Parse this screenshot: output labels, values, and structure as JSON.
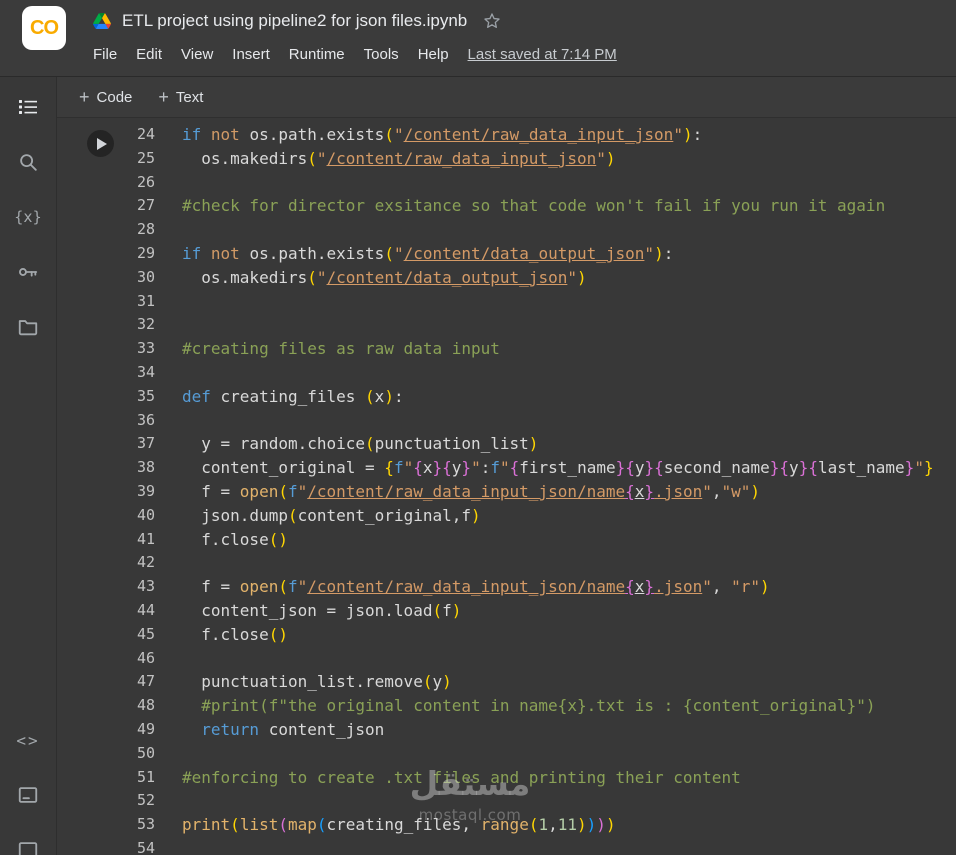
{
  "header": {
    "logo_text": "CO",
    "title": "ETL project using pipeline2 for json files.ipynb",
    "menu": [
      "File",
      "Edit",
      "View",
      "Insert",
      "Runtime",
      "Tools",
      "Help"
    ],
    "last_saved": "Last saved at 7:14 PM"
  },
  "toolbar": {
    "code_label": "Code",
    "text_label": "Text"
  },
  "icons": {
    "plus": "+",
    "variables": "{x}",
    "code_snippets": "<>"
  },
  "watermark": {
    "arabic": "مستقل",
    "domain": "mostaql.com"
  },
  "colors": {
    "logo_orange": "#f9ab00",
    "text": "#d9d9d9",
    "keyword": "#569cd6",
    "not_keyword": "#d19a66",
    "string": "#d49a66",
    "comment": "#8aa156",
    "builtin": "#e3b36b",
    "number": "#b5cea8",
    "bracket_gold": "#ffd602",
    "bracket_pink": "#da70d6",
    "bracket_blue": "#179fff"
  },
  "editor": {
    "lines": [
      {
        "num": 24,
        "tokens": [
          [
            "k",
            "if"
          ],
          [
            "t",
            " "
          ],
          [
            "o",
            "not"
          ],
          [
            "t",
            " os.path.exists"
          ],
          [
            "g",
            "("
          ],
          [
            "s",
            "\""
          ],
          [
            "su",
            "/content/raw_data_input_json"
          ],
          [
            "s",
            "\""
          ],
          [
            "g",
            ")"
          ],
          [
            "t",
            ":"
          ]
        ]
      },
      {
        "num": 25,
        "tokens": [
          [
            "t",
            "  os.makedirs"
          ],
          [
            "g",
            "("
          ],
          [
            "s",
            "\""
          ],
          [
            "su",
            "/content/raw_data_input_json"
          ],
          [
            "s",
            "\""
          ],
          [
            "g",
            ")"
          ]
        ]
      },
      {
        "num": 26,
        "tokens": []
      },
      {
        "num": 27,
        "tokens": [
          [
            "c",
            "#check for director exsitance so that code won't fail if you run it again"
          ]
        ]
      },
      {
        "num": 28,
        "tokens": []
      },
      {
        "num": 29,
        "tokens": [
          [
            "k",
            "if"
          ],
          [
            "t",
            " "
          ],
          [
            "o",
            "not"
          ],
          [
            "t",
            " os.path.exists"
          ],
          [
            "g",
            "("
          ],
          [
            "s",
            "\""
          ],
          [
            "su",
            "/content/data_output_json"
          ],
          [
            "s",
            "\""
          ],
          [
            "g",
            ")"
          ],
          [
            "t",
            ":"
          ]
        ]
      },
      {
        "num": 30,
        "tokens": [
          [
            "t",
            "  os.makedirs"
          ],
          [
            "g",
            "("
          ],
          [
            "s",
            "\""
          ],
          [
            "su",
            "/content/data_output_json"
          ],
          [
            "s",
            "\""
          ],
          [
            "g",
            ")"
          ]
        ]
      },
      {
        "num": 31,
        "tokens": []
      },
      {
        "num": 32,
        "tokens": []
      },
      {
        "num": 33,
        "tokens": [
          [
            "c",
            "#creating files as raw data input"
          ]
        ]
      },
      {
        "num": 34,
        "tokens": []
      },
      {
        "num": 35,
        "tokens": [
          [
            "k",
            "def"
          ],
          [
            "t",
            " creating_files "
          ],
          [
            "g",
            "("
          ],
          [
            "t",
            "x"
          ],
          [
            "g",
            ")"
          ],
          [
            "t",
            ":"
          ]
        ]
      },
      {
        "num": 36,
        "tokens": []
      },
      {
        "num": 37,
        "tokens": [
          [
            "t",
            "  y = random.choice"
          ],
          [
            "g",
            "("
          ],
          [
            "t",
            "punctuation_list"
          ],
          [
            "g",
            ")"
          ]
        ]
      },
      {
        "num": 38,
        "tokens": [
          [
            "t",
            "  content_original = "
          ],
          [
            "g",
            "{"
          ],
          [
            "k",
            "f"
          ],
          [
            "s",
            "\""
          ],
          [
            "p",
            "{"
          ],
          [
            "t",
            "x"
          ],
          [
            "p",
            "}"
          ],
          [
            "p",
            "{"
          ],
          [
            "t",
            "y"
          ],
          [
            "p",
            "}"
          ],
          [
            "s",
            "\""
          ],
          [
            "t",
            ":"
          ],
          [
            "k",
            "f"
          ],
          [
            "s",
            "\""
          ],
          [
            "p",
            "{"
          ],
          [
            "t",
            "first_name"
          ],
          [
            "p",
            "}"
          ],
          [
            "p",
            "{"
          ],
          [
            "t",
            "y"
          ],
          [
            "p",
            "}"
          ],
          [
            "p",
            "{"
          ],
          [
            "t",
            "second_name"
          ],
          [
            "p",
            "}"
          ],
          [
            "p",
            "{"
          ],
          [
            "t",
            "y"
          ],
          [
            "p",
            "}"
          ],
          [
            "p",
            "{"
          ],
          [
            "t",
            "last_name"
          ],
          [
            "p",
            "}"
          ],
          [
            "s",
            "\""
          ],
          [
            "g",
            "}"
          ]
        ]
      },
      {
        "num": 39,
        "tokens": [
          [
            "t",
            "  f = "
          ],
          [
            "f",
            "open"
          ],
          [
            "g",
            "("
          ],
          [
            "k",
            "f"
          ],
          [
            "s",
            "\""
          ],
          [
            "su",
            "/content/raw_data_input_json/name"
          ],
          [
            "pu",
            "{"
          ],
          [
            "tu",
            "x"
          ],
          [
            "pu",
            "}"
          ],
          [
            "su",
            ".json"
          ],
          [
            "s",
            "\""
          ],
          [
            "t",
            ","
          ],
          [
            "s",
            "\"w\""
          ],
          [
            "g",
            ")"
          ]
        ]
      },
      {
        "num": 40,
        "tokens": [
          [
            "t",
            "  json.dump"
          ],
          [
            "g",
            "("
          ],
          [
            "t",
            "content_original,f"
          ],
          [
            "g",
            ")"
          ]
        ]
      },
      {
        "num": 41,
        "tokens": [
          [
            "t",
            "  f.close"
          ],
          [
            "g",
            "("
          ],
          [
            "g",
            ")"
          ]
        ]
      },
      {
        "num": 42,
        "tokens": []
      },
      {
        "num": 43,
        "tokens": [
          [
            "t",
            "  f = "
          ],
          [
            "f",
            "open"
          ],
          [
            "g",
            "("
          ],
          [
            "k",
            "f"
          ],
          [
            "s",
            "\""
          ],
          [
            "su",
            "/content/raw_data_input_json/name"
          ],
          [
            "pu",
            "{"
          ],
          [
            "tu",
            "x"
          ],
          [
            "pu",
            "}"
          ],
          [
            "su",
            ".json"
          ],
          [
            "s",
            "\""
          ],
          [
            "t",
            ", "
          ],
          [
            "s",
            "\"r\""
          ],
          [
            "g",
            ")"
          ]
        ]
      },
      {
        "num": 44,
        "tokens": [
          [
            "t",
            "  content_json = json.load"
          ],
          [
            "g",
            "("
          ],
          [
            "t",
            "f"
          ],
          [
            "g",
            ")"
          ]
        ]
      },
      {
        "num": 45,
        "tokens": [
          [
            "t",
            "  f.close"
          ],
          [
            "g",
            "("
          ],
          [
            "g",
            ")"
          ]
        ]
      },
      {
        "num": 46,
        "tokens": []
      },
      {
        "num": 47,
        "tokens": [
          [
            "t",
            "  punctuation_list.remove"
          ],
          [
            "g",
            "("
          ],
          [
            "t",
            "y"
          ],
          [
            "g",
            ")"
          ]
        ]
      },
      {
        "num": 48,
        "tokens": [
          [
            "c",
            "  #print(f\"the original content in name{x}.txt is : {content_original}\")"
          ]
        ]
      },
      {
        "num": 49,
        "tokens": [
          [
            "t",
            "  "
          ],
          [
            "k",
            "return"
          ],
          [
            "t",
            " content_json"
          ]
        ]
      },
      {
        "num": 50,
        "tokens": []
      },
      {
        "num": 51,
        "tokens": [
          [
            "c",
            "#enforcing to create .txt files and printing their content"
          ]
        ]
      },
      {
        "num": 52,
        "tokens": []
      },
      {
        "num": 53,
        "tokens": [
          [
            "f",
            "print"
          ],
          [
            "g",
            "("
          ],
          [
            "f",
            "list"
          ],
          [
            "p",
            "("
          ],
          [
            "f",
            "map"
          ],
          [
            "b",
            "("
          ],
          [
            "t",
            "creating_files, "
          ],
          [
            "f",
            "range"
          ],
          [
            "g",
            "("
          ],
          [
            "n",
            "1"
          ],
          [
            "t",
            ","
          ],
          [
            "n",
            "11"
          ],
          [
            "g",
            ")"
          ],
          [
            "b",
            ")"
          ],
          [
            "p",
            ")"
          ],
          [
            "g",
            ")"
          ]
        ]
      },
      {
        "num": 54,
        "tokens": []
      }
    ]
  }
}
